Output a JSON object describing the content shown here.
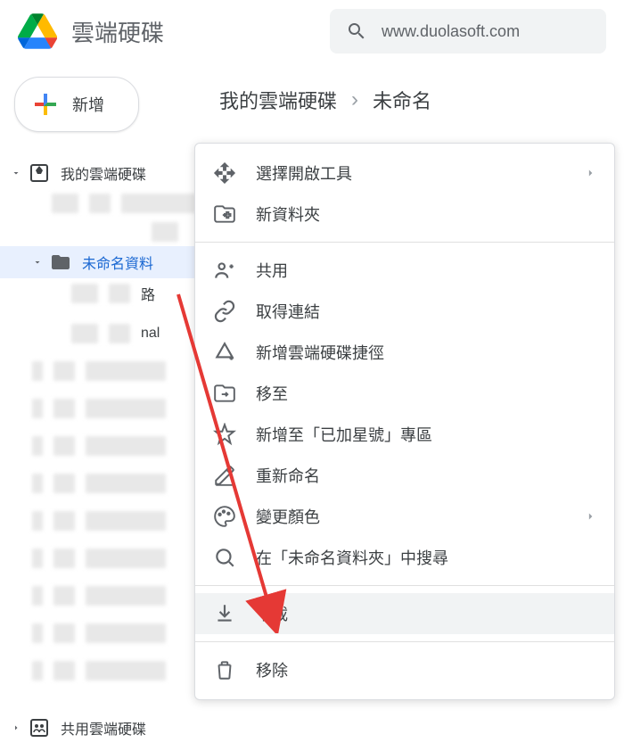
{
  "header": {
    "app_title": "雲端硬碟",
    "search_text": "www.duolasoft.com"
  },
  "sidebar": {
    "new_label": "新增",
    "tree": {
      "root_label": "我的雲端硬碟",
      "selected_label": "未命名資料",
      "child_partial1": "路",
      "child_partial2": "nal",
      "shared_label": "共用雲端硬碟"
    }
  },
  "breadcrumb": {
    "item1": "我的雲端硬碟",
    "item2": "未命名"
  },
  "menu": {
    "open_with": "選擇開啟工具",
    "new_folder": "新資料夾",
    "share": "共用",
    "get_link": "取得連結",
    "add_shortcut": "新增雲端硬碟捷徑",
    "move_to": "移至",
    "add_starred": "新增至「已加星號」專區",
    "rename": "重新命名",
    "change_color": "變更顏色",
    "search_in": "在「未命名資料夾」中搜尋",
    "download": "下載",
    "remove": "移除"
  }
}
